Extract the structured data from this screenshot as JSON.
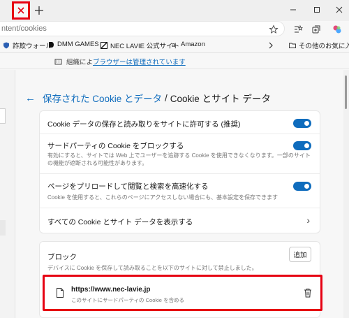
{
  "browser": {
    "address": "ntent/cookies",
    "favorites": [
      {
        "label": "詐欺ウォール",
        "icon": "shield-icon"
      },
      {
        "label": "DMM GAMES",
        "icon": "dmm-icon"
      },
      {
        "label": "NEC LAVIE 公式サイト",
        "icon": "nec-icon"
      },
      {
        "label": "Amazon",
        "icon": "amazon-icon"
      }
    ],
    "other_favorites": "その他のお気に入り",
    "managed_prefix": "組織によ",
    "managed_link": "ブラウザーは管理されています"
  },
  "heading": {
    "back_glyph": "←",
    "crumb": "保存された Cookie とデータ",
    "separator": "/",
    "current": "Cookie とサイト データ"
  },
  "settings": {
    "allow": {
      "title": "Cookie データの保存と読み取りをサイトに許可する (推奨)",
      "enabled": true
    },
    "third_party": {
      "title": "サードパーティの Cookie をブロックする",
      "desc": "有効にすると、サイトでは Web 上でユーザーを追跡する Cookie を使用できなくなります。一部のサイトの機能が遮断される可能性があります。",
      "enabled": true
    },
    "preload": {
      "title": "ページをプリロードして閲覧と検索を高速化する",
      "desc": "Cookie を使用すると、これらのページにアクセスしない場合にも、基本設定を保存できます",
      "enabled": true
    },
    "show_all": {
      "title": "すべての Cookie とサイト データを表示する",
      "chevron": "›"
    }
  },
  "block": {
    "title": "ブロック",
    "desc": "デバイスに Cookie を保存して読み取ることを以下のサイトに対して禁止しました。",
    "add_label": "追加",
    "sites": [
      {
        "url": "https://www.nec-lavie.jp",
        "sub": "このサイトにサードパーティの Cookie を含める"
      }
    ]
  },
  "colors": {
    "accent": "#0f6cbd",
    "highlight": "#e60012"
  }
}
